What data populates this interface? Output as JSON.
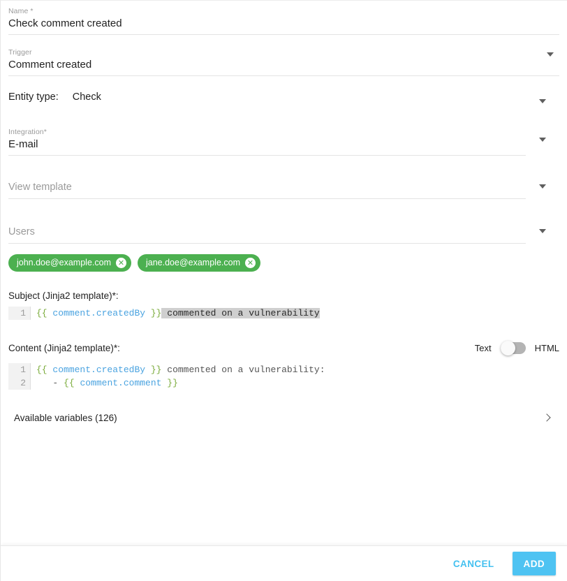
{
  "form": {
    "name_field": {
      "label": "Name *",
      "value": "Check comment created"
    },
    "trigger_field": {
      "label": "Trigger",
      "value": "Comment created",
      "caret_icon": "chevron-down-icon"
    },
    "entity_type_field": {
      "label": "Entity type:",
      "value": "Check",
      "caret_icon": "chevron-down-icon"
    },
    "integration_field": {
      "label": "Integration*",
      "value": "E-mail",
      "caret_icon": "chevron-down-icon"
    },
    "view_template_field": {
      "placeholder": "View template",
      "value": "",
      "caret_icon": "chevron-down-icon"
    },
    "users_field": {
      "placeholder": "Users",
      "value": "",
      "caret_icon": "chevron-down-icon"
    },
    "user_chips": [
      {
        "email": "john.doe@example.com",
        "remove_icon": "✕"
      },
      {
        "email": "jane.doe@example.com",
        "remove_icon": "✕"
      }
    ]
  },
  "subject_editor": {
    "title": "Subject (Jinja2 template)*:",
    "lines": [
      {
        "number": "1",
        "tokens": [
          {
            "text": "{{",
            "type": "brace"
          },
          {
            "text": " ",
            "type": "plain"
          },
          {
            "text": "comment.createdBy",
            "type": "var"
          },
          {
            "text": " ",
            "type": "plain"
          },
          {
            "text": "}}",
            "type": "brace"
          },
          {
            "text": " commented on a vulnerability",
            "type": "selected"
          }
        ]
      }
    ]
  },
  "content_editor": {
    "title": "Content (Jinja2 template)*:",
    "toggle": {
      "left_label": "Text",
      "right_label": "HTML",
      "state": "left"
    },
    "lines": [
      {
        "number": "1",
        "tokens": [
          {
            "text": "{{",
            "type": "brace"
          },
          {
            "text": " ",
            "type": "plain"
          },
          {
            "text": "comment.createdBy",
            "type": "var"
          },
          {
            "text": " ",
            "type": "plain"
          },
          {
            "text": "}}",
            "type": "brace"
          },
          {
            "text": " commented on a vulnerability:",
            "type": "plain"
          }
        ]
      },
      {
        "number": "2",
        "tokens": [
          {
            "text": "   - ",
            "type": "plain"
          },
          {
            "text": "{{",
            "type": "brace"
          },
          {
            "text": " ",
            "type": "plain"
          },
          {
            "text": "comment.comment",
            "type": "var"
          },
          {
            "text": " ",
            "type": "plain"
          },
          {
            "text": "}}",
            "type": "brace"
          }
        ]
      }
    ]
  },
  "available_variables": {
    "label": "Available variables (126)",
    "chevron_icon": "chevron-right-icon"
  },
  "footer": {
    "cancel_label": "CANCEL",
    "add_label": "ADD"
  },
  "colors": {
    "chip_green": "#4cb050",
    "accent_blue": "#4ec3f2",
    "code_var": "#4aa3e0",
    "code_brace": "#7aab3a",
    "selection_gray": "#cfcfcf"
  }
}
